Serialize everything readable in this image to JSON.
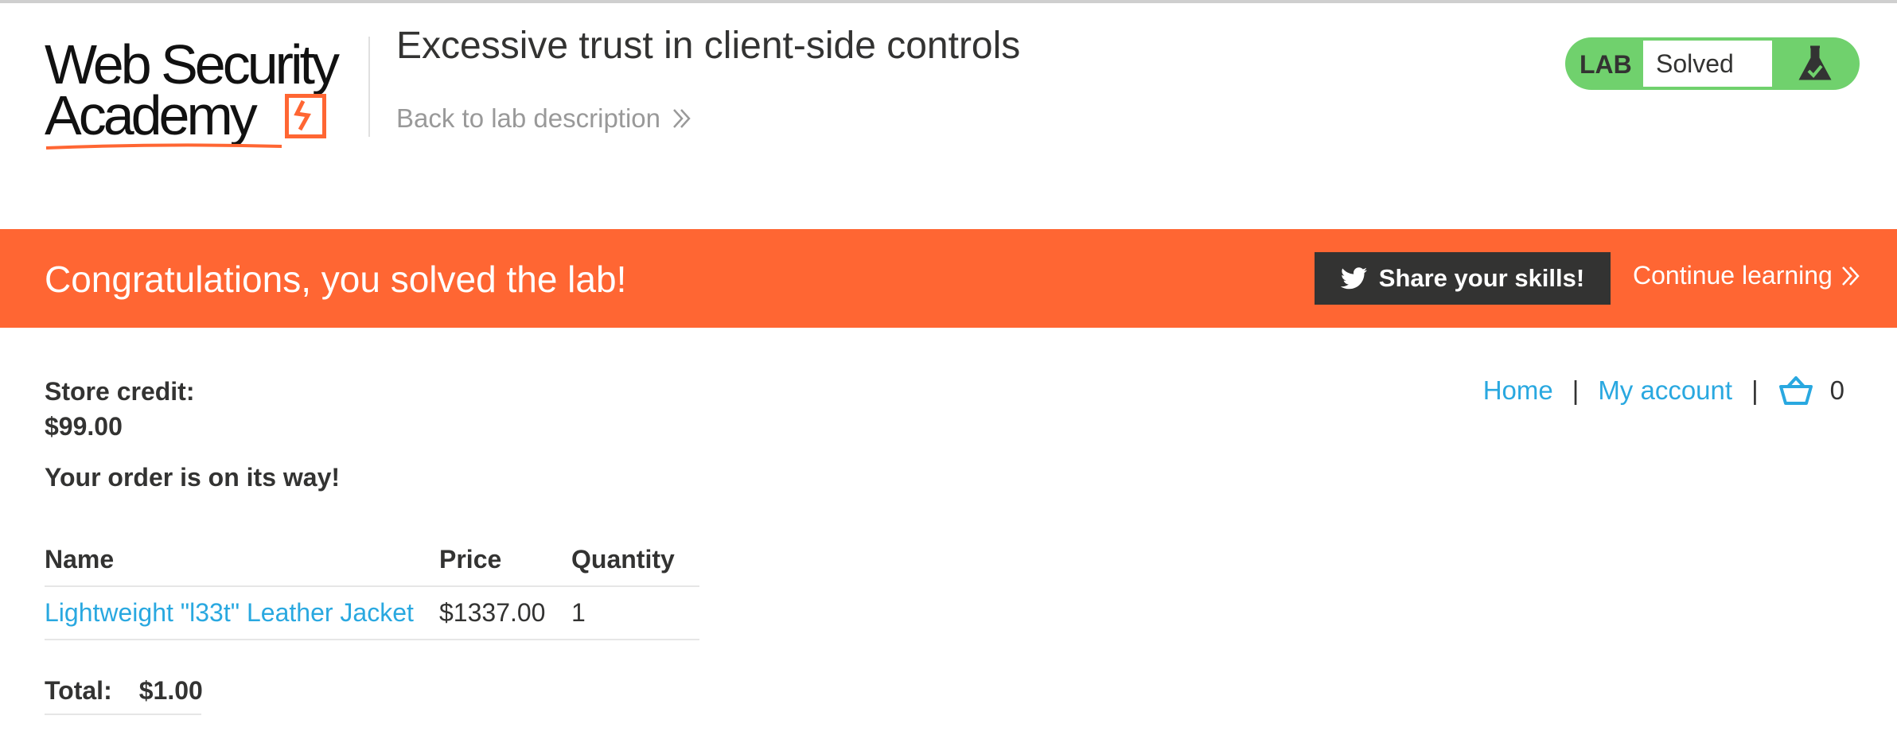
{
  "header": {
    "logo_line1": "Web Security",
    "logo_line2": "Academy",
    "lab_title": "Excessive trust in client-side controls",
    "back_link": "Back to lab description",
    "lab_badge": {
      "label": "LAB",
      "status": "Solved",
      "icon": "flask-icon"
    }
  },
  "banner": {
    "message": "Congratulations, you solved the lab!",
    "share_label": "Share your skills!",
    "share_icon": "twitter-icon",
    "continue_label": "Continue learning",
    "color": "#ff6633"
  },
  "nav": {
    "home": "Home",
    "separator": "|",
    "my_account": "My account",
    "cart_icon": "cart-icon",
    "cart_count": "0"
  },
  "store_credit": {
    "label": "Store credit:",
    "value": "$99.00"
  },
  "order_message": "Your order is on its way!",
  "order_table": {
    "headers": [
      "Name",
      "Price",
      "Quantity"
    ],
    "rows": [
      {
        "name": "Lightweight \"l33t\" Leather Jacket",
        "price": "$1337.00",
        "quantity": "1"
      }
    ]
  },
  "total": {
    "label": "Total:",
    "value": "$1.00"
  },
  "colors": {
    "accent": "#ff6633",
    "link": "#29a8e0",
    "lab_green": "#70d16d",
    "dark": "#333332"
  }
}
